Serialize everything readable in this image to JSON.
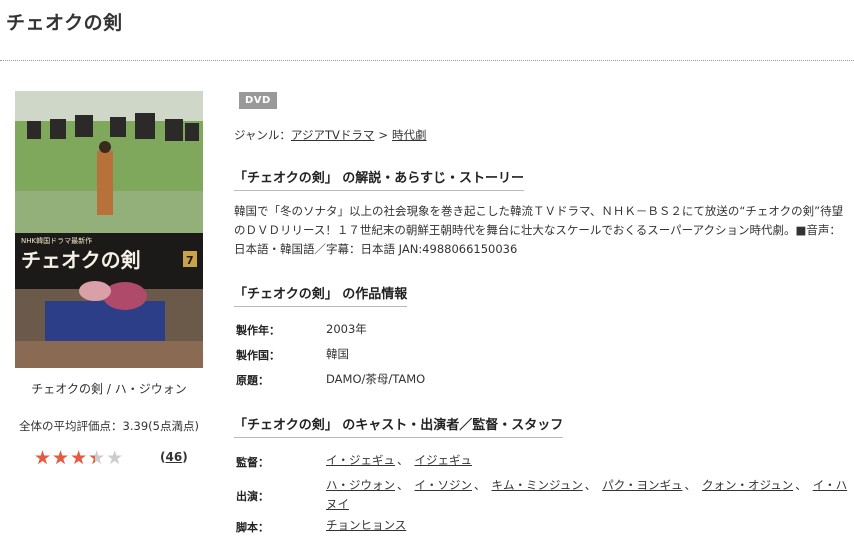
{
  "page": {
    "title": "チェオクの剣"
  },
  "product": {
    "badge": "DVD",
    "cover_title": "チェオクの剣",
    "cover_header": "NHK韓国ドラマ最新作",
    "cover_volume": "7",
    "caption": "チェオクの剣 / ハ・ジウォン",
    "avg_rating_text": "全体の平均評価点：3.39(5点満点)",
    "rating": 3.39,
    "rating_max": 5,
    "review_count": "46"
  },
  "genre": {
    "label": "ジャンル：",
    "items": [
      "アジアTVドラマ",
      "時代劇"
    ],
    "sep": ">"
  },
  "colors": {
    "star": "#e8593f",
    "badge": "#999999"
  },
  "sections": {
    "story_title": "「チェオクの剣」 の解説・あらすじ・ストーリー",
    "story_text": "韓国で「冬のソナタ」以上の社会現象を巻き起こした韓流ＴＶドラマ、ＮＨＫ－ＢＳ２にて放送の“チェオクの剣”待望のＤＶＤリリース！１７世紀末の朝鮮王朝時代を舞台に壮大なスケールでおくるスーパーアクション時代劇。■音声：日本語・韓国語／字幕：日本語 JAN:4988066150036",
    "info_title": "「チェオクの剣」 の作品情報",
    "info": [
      {
        "label": "製作年：",
        "value": "2003年"
      },
      {
        "label": "製作国：",
        "value": "韓国"
      },
      {
        "label": "原題：",
        "value": "DAMO/茶母/TAMO"
      }
    ],
    "cast_title": "「チェオクの剣」 のキャスト・出演者／監督・スタッフ",
    "director_label": "監督：",
    "directors": [
      "イ・ジェギュ",
      "イジェギュ"
    ],
    "cast_label": "出演：",
    "cast": [
      "ハ・ジウォン",
      "イ・ソジン",
      "キム・ミンジュン",
      "パク・ヨンギュ",
      "クォン・オジュン",
      "イ・ハヌイ"
    ],
    "writer_label": "脚本：",
    "writers": [
      "チョンヒョンス"
    ]
  }
}
